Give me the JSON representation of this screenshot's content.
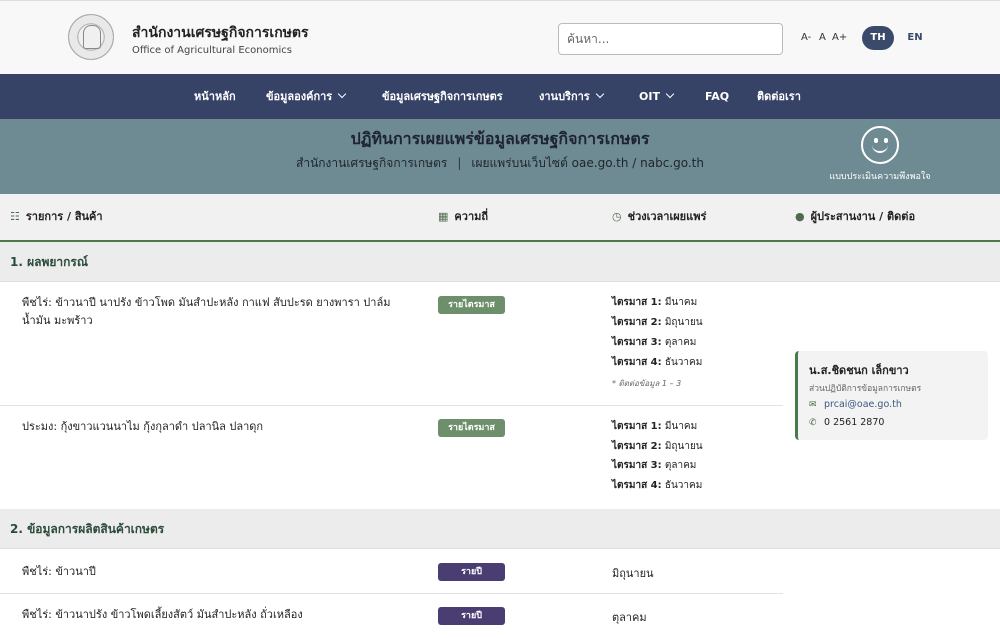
{
  "header": {
    "org_name_th": "สำนักงานเศรษฐกิจการเกษตร",
    "org_name_en": "Office of Agricultural Economics",
    "search_placeholder": "ค้นหา...",
    "font_size_controls": [
      "A-",
      "A",
      "A+"
    ],
    "languages": {
      "active": "TH",
      "other": "EN"
    }
  },
  "nav": {
    "items": [
      {
        "label": "หน้าหลัก",
        "dropdown": false
      },
      {
        "label": "ข้อมูลองค์การ",
        "dropdown": true
      },
      {
        "label": "ข้อมูลเศรษฐกิจการเกษตร",
        "dropdown": false
      },
      {
        "label": "งานบริการ",
        "dropdown": true
      },
      {
        "label": "OIT",
        "dropdown": true
      },
      {
        "label": "FAQ",
        "dropdown": false
      },
      {
        "label": "ติดต่อเรา",
        "dropdown": false
      }
    ]
  },
  "banner": {
    "title": "ปฏิทินการเผยแพร่ข้อมูลเศรษฐกิจการเกษตร",
    "subtitle_left": "สำนักงานเศรษฐกิจการเกษตร",
    "subtitle_sep": "|",
    "subtitle_right": "เผยแพร่บนเว็บไซต์ oae.go.th / nabc.go.th",
    "survey_label": "แบบประเมินความพึงพอใจ"
  },
  "table": {
    "columns": [
      "รายการ / สินค้า",
      "ความถี่",
      "ช่วงเวลาเผยแพร่",
      "ผู้ประสานงาน / ติดต่อ"
    ],
    "sections": [
      {
        "title": "1. ผลพยากรณ์",
        "rows": [
          {
            "item": "พืชไร่: ข้าวนาปี นาปรัง ข้าวโพด มันสำปะหลัง กาแฟ สับปะรด ยางพารา ปาล์มน้ำมัน มะพร้าว",
            "frequency": "รายไตรมาส",
            "schedule": [
              {
                "q": "ไตรมาส 1:",
                "m": "มีนาคม"
              },
              {
                "q": "ไตรมาส 2:",
                "m": "มิถุนายน"
              },
              {
                "q": "ไตรมาส 3:",
                "m": "ตุลาคม"
              },
              {
                "q": "ไตรมาส 4:",
                "m": "ธันวาคม"
              }
            ],
            "note": "* ติดต่อข้อมูล 1 – 3"
          },
          {
            "item": "ประมง: กุ้งขาวแวนนาไม กุ้งกุลาดำ ปลานิล ปลาดุก",
            "frequency": "รายไตรมาส",
            "schedule": [
              {
                "q": "ไตรมาส 1:",
                "m": "มีนาคม"
              },
              {
                "q": "ไตรมาส 2:",
                "m": "มิถุนายน"
              },
              {
                "q": "ไตรมาส 3:",
                "m": "ตุลาคม"
              },
              {
                "q": "ไตรมาส 4:",
                "m": "ธันวาคม"
              }
            ]
          }
        ]
      },
      {
        "title": "2. ข้อมูลการผลิตสินค้าเกษตร",
        "rows": [
          {
            "item": "พืชไร่: ข้าวนาปี",
            "frequency": "รายปี",
            "month": "มิถุนายน"
          },
          {
            "item": "พืชไร่: ข้าวนาปรัง ข้าวโพดเลี้ยงสัตว์ มันสำปะหลัง ถั่วเหลือง",
            "frequency": "รายปี",
            "month": "ตุลาคม"
          }
        ]
      }
    ]
  },
  "contact": {
    "name": "น.ส.ชิดชนก เล็กขาว",
    "unit": "ส่วนปฏิบัติการข้อมูลการเกษตร",
    "email": "prcai@oae.go.th",
    "phone": "0 2561 2870"
  },
  "colors": {
    "nav_bg": "#364367",
    "banner_bg": "#6e8a93",
    "quarterly_badge": "#6d8f6b",
    "yearly_badge": "#4a3d72",
    "accent_green": "#4a7a4a"
  }
}
